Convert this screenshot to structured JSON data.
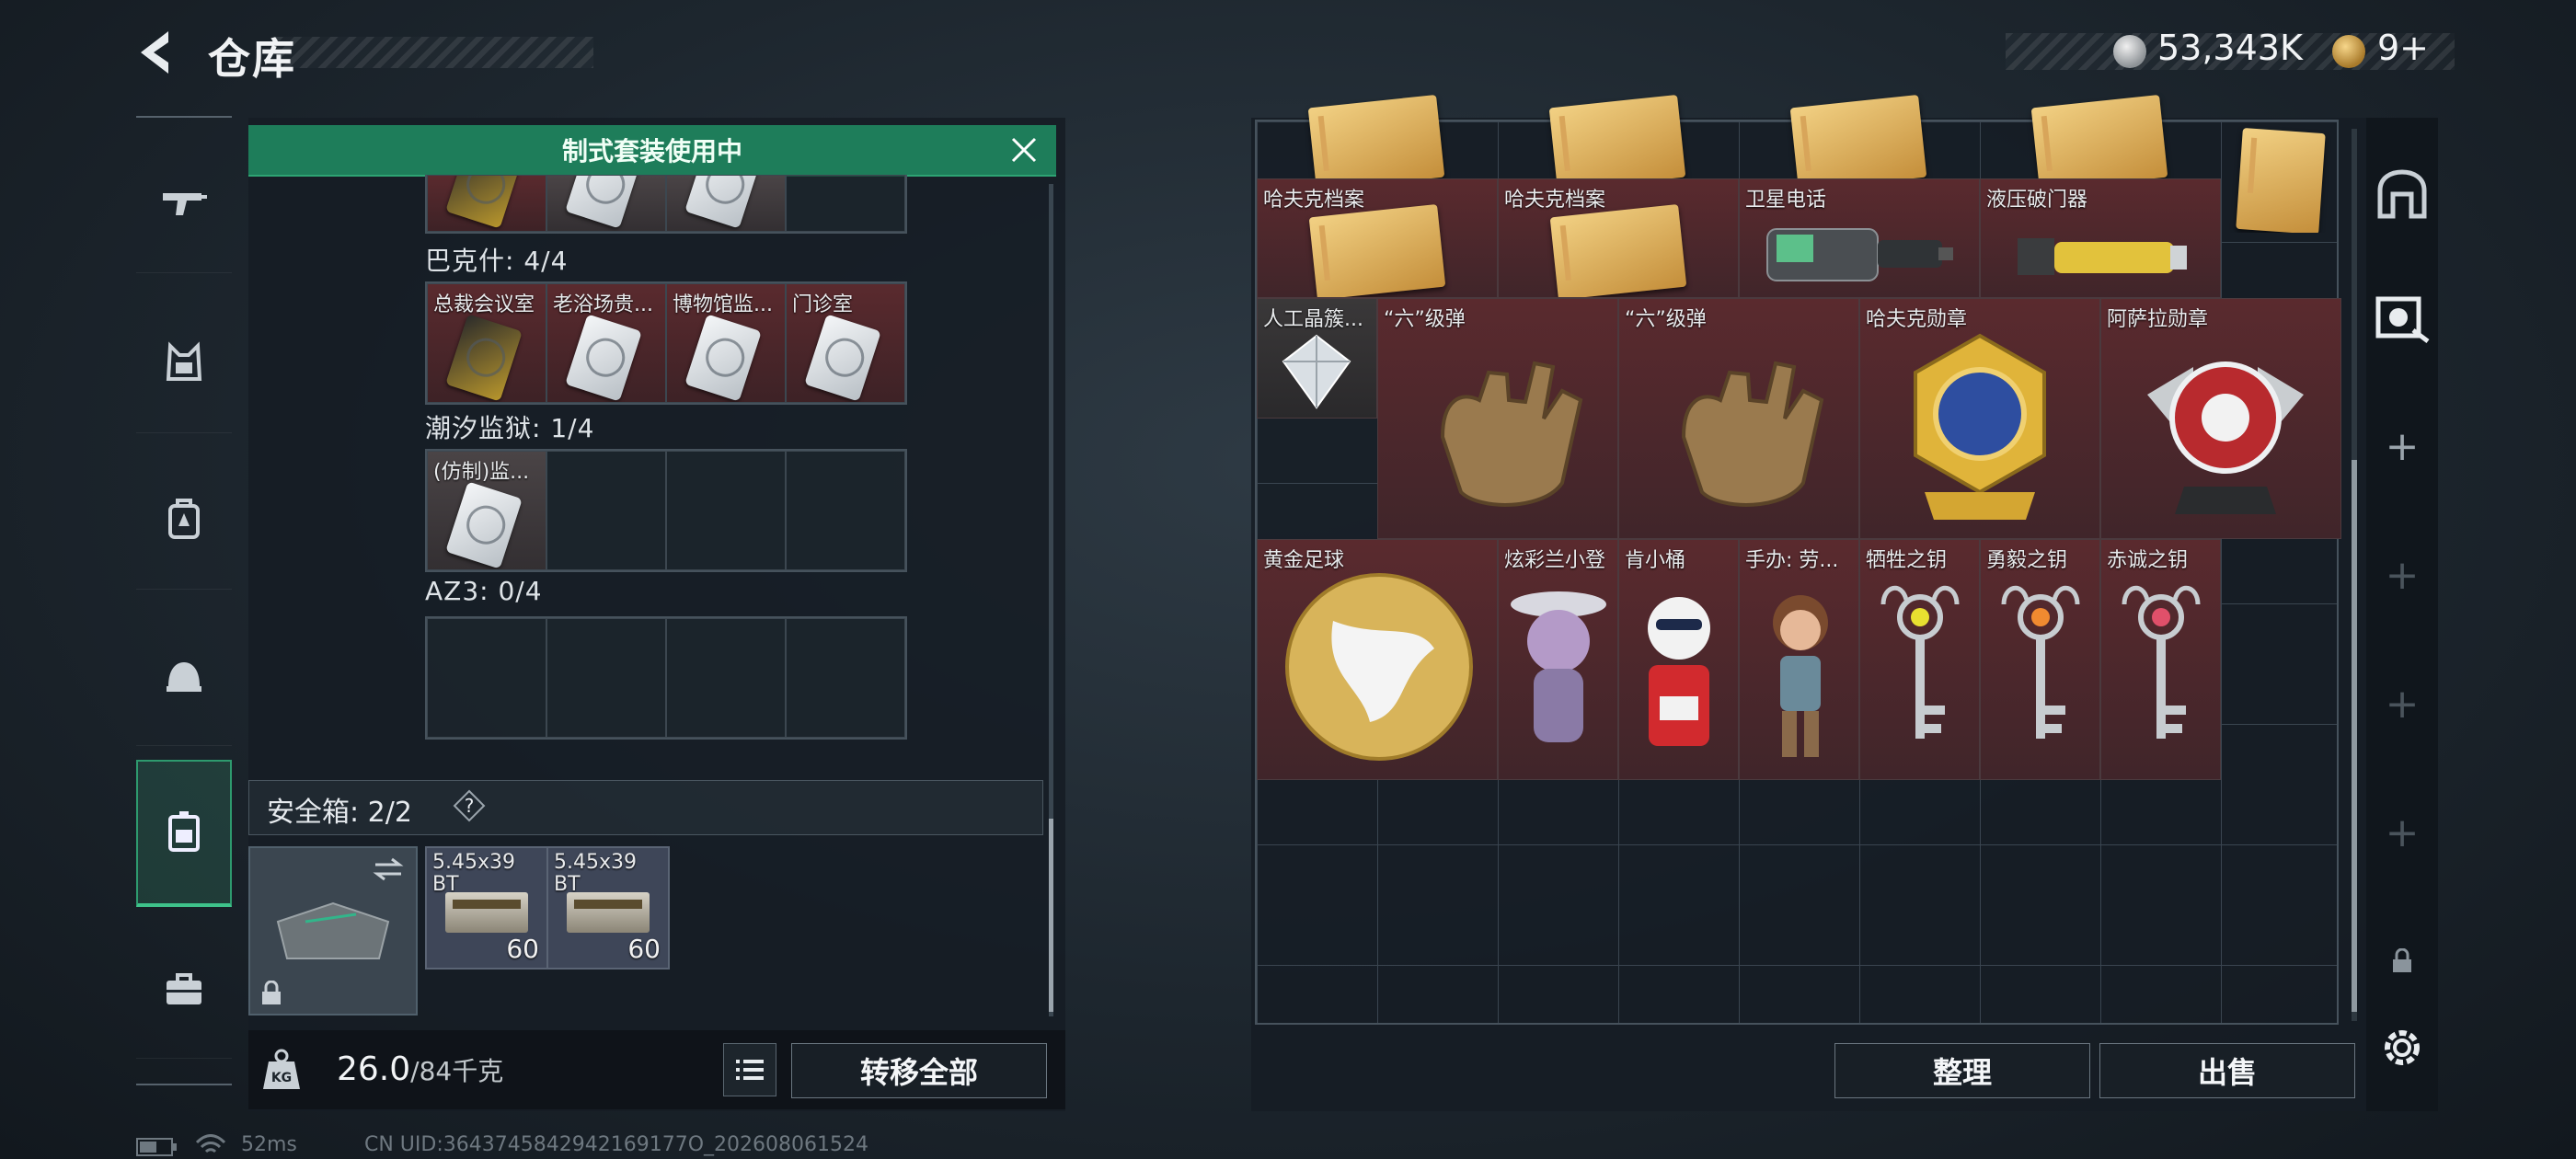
{
  "header": {
    "title": "仓库",
    "silver_value": "53,343K",
    "gold_value": "9+"
  },
  "banner": {
    "text": "制式套装使用中"
  },
  "left": {
    "sections": [
      {
        "label": "巴克什: 4/4",
        "items": [
          "总裁会议室",
          "老浴场贵...",
          "博物馆监...",
          "门诊室"
        ]
      },
      {
        "label": "潮汐监狱: 1/4",
        "items": [
          "(仿制)监..."
        ]
      },
      {
        "label": "AZ3: 0/4",
        "items": []
      }
    ],
    "safe_box_label": "安全箱: 2/2",
    "help": "?",
    "ammo": [
      {
        "name": "5.45x39 BT",
        "count": "60"
      },
      {
        "name": "5.45x39 BT",
        "count": "60"
      }
    ],
    "weight_current": "26.0",
    "weight_capacity": "/84千克",
    "transfer_all": "转移全部"
  },
  "right": {
    "items": [
      {
        "label": "哈夫克档案"
      },
      {
        "label": "哈夫克档案"
      },
      {
        "label": "卫星电话"
      },
      {
        "label": "液压破门器"
      },
      {
        "label": "人工晶簇..."
      },
      {
        "label": "“六”级弹"
      },
      {
        "label": "“六”级弹"
      },
      {
        "label": "哈夫克勋章"
      },
      {
        "label": "阿萨拉勋章"
      },
      {
        "label": "黄金足球"
      },
      {
        "label": "炫彩兰小登"
      },
      {
        "label": "肯小桶"
      },
      {
        "label": "手办: 劳..."
      },
      {
        "label": "牺牲之钥"
      },
      {
        "label": "勇毅之钥"
      },
      {
        "label": "赤诚之钥"
      }
    ],
    "sort_button": "整理",
    "sell_button": "出售"
  },
  "footer": {
    "ping": "52ms",
    "uid": "CN UID:3643745842942169177O_202608061524"
  },
  "colors": {
    "accent_green": "#1e7d5a",
    "rarity_red": "#5a2a2e",
    "panel": "#161d24"
  }
}
